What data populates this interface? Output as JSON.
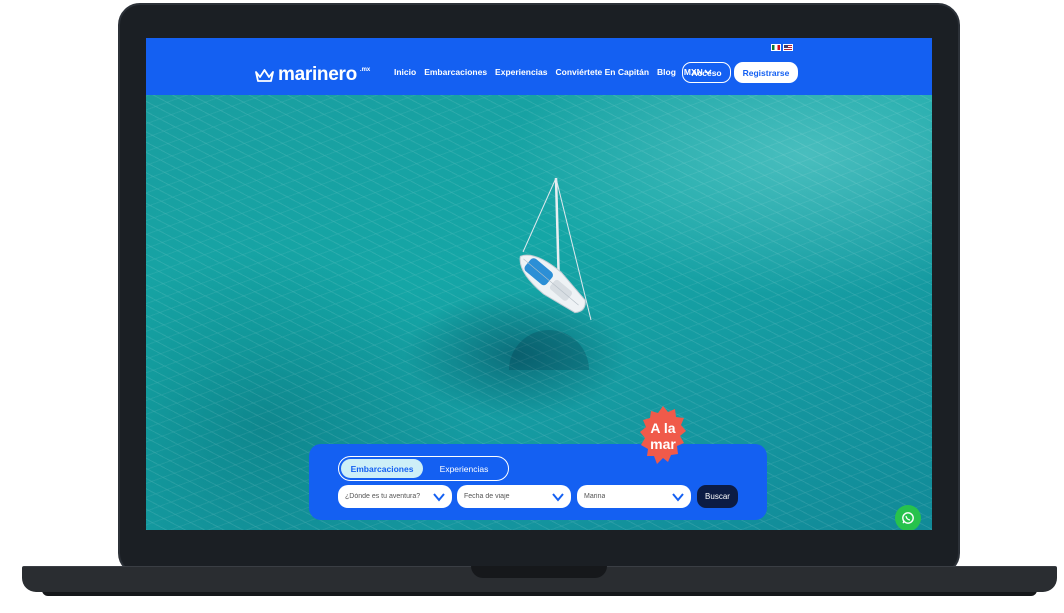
{
  "header": {
    "logo_text": "marinero",
    "logo_sup": ".mx",
    "nav": [
      "Inicio",
      "Embarcaciones",
      "Experiencias",
      "Conviértete En Capitán",
      "Blog"
    ],
    "currency": "MXN",
    "login_label": "Acceso",
    "register_label": "Registrarse"
  },
  "badge": {
    "line1": "A la",
    "line2": "mar"
  },
  "search": {
    "tabs": [
      {
        "label": "Embarcaciones",
        "active": true
      },
      {
        "label": "Experiencias",
        "active": false
      }
    ],
    "fields": [
      {
        "value": "¿Dónde es tu aventura?"
      },
      {
        "value": "Fecha de viaje"
      },
      {
        "value": "Marina"
      }
    ],
    "submit_label": "Buscar"
  },
  "colors": {
    "brand_blue": "#1460f2",
    "tab_active_bg": "#cdeff7",
    "button_dark": "#0c1c45",
    "badge_red": "#f05a4a",
    "whatsapp_green": "#27c24c"
  }
}
